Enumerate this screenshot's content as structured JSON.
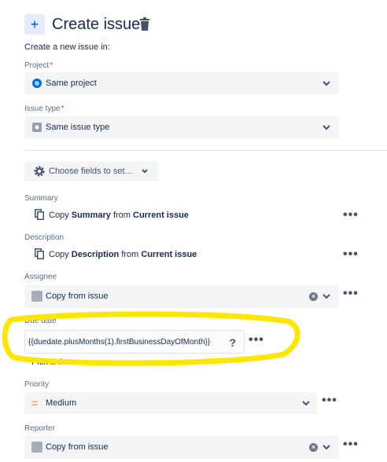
{
  "header": {
    "plus_glyph": "+",
    "title": "Create issue",
    "subtitle": "Create a new issue in:"
  },
  "project": {
    "label": "Project",
    "required_mark": "*",
    "value": "Same project"
  },
  "issue_type": {
    "label": "Issue type",
    "required_mark": "*",
    "value": "Same issue type"
  },
  "choose_fields": {
    "label": "Choose fields to set..."
  },
  "fields": {
    "summary": {
      "label": "Summary",
      "copy_prefix": "Copy ",
      "field_name": "Summary",
      "from_word": " from ",
      "source": "Current issue"
    },
    "description": {
      "label": "Description",
      "copy_prefix": "Copy ",
      "field_name": "Description",
      "from_word": " from ",
      "source": "Current issue"
    },
    "assignee": {
      "label": "Assignee",
      "value": "Copy from issue"
    },
    "due_date": {
      "label": "Due date",
      "value": "{{duedate.plusMonths(1).firstBusinessDayOfMonth}}",
      "help_glyph": "?",
      "pick_link": "Pick a date"
    },
    "priority": {
      "label": "Priority",
      "value": "Medium"
    },
    "reporter": {
      "label": "Reporter",
      "value": "Copy from issue"
    }
  },
  "more_glyph": "•••",
  "clear_glyph": "×",
  "colors": {
    "highlight": "#ffe600",
    "accent": "#0052cc",
    "field_bg": "#f4f5f7",
    "priority_medium": "#ffab00"
  }
}
